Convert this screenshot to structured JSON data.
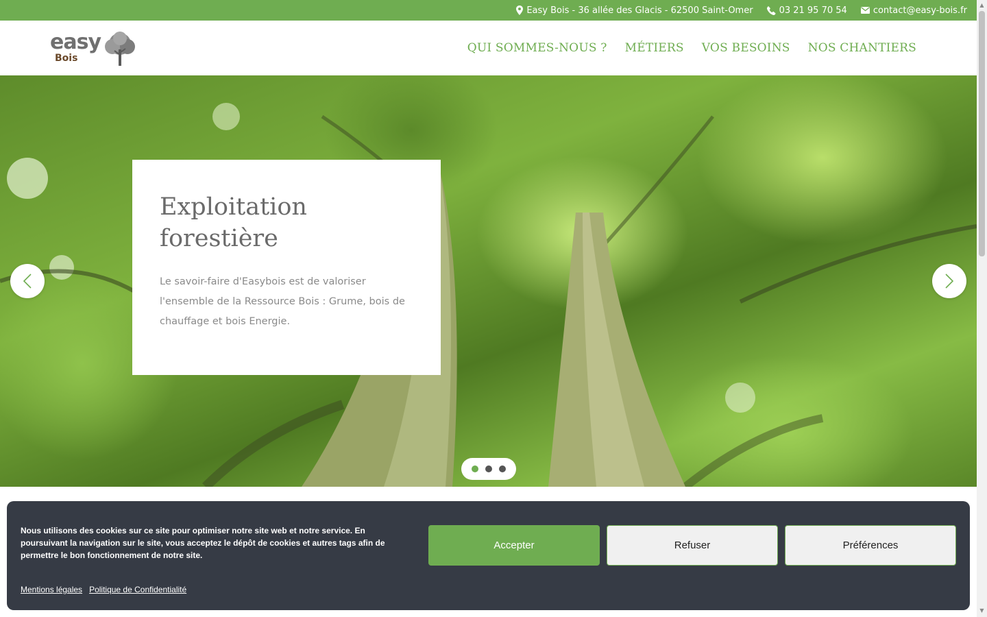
{
  "topbar": {
    "address": "Easy Bois - 36 allée des Glacis - 62500 Saint-Omer",
    "phone": "03 21 95 70 54",
    "email": "contact@easy-bois.fr"
  },
  "logo": {
    "word": "easy",
    "sub": "Bois"
  },
  "nav": [
    {
      "label": "QUI SOMMES-NOUS ?"
    },
    {
      "label": "MÉTIERS"
    },
    {
      "label": "VOS BESOINS"
    },
    {
      "label": "NOS CHANTIERS"
    }
  ],
  "hero": {
    "title_line1": "Exploitation",
    "title_line2": "forestière",
    "text": "Le savoir-faire d'Easybois est de valoriser l'ensemble de la Ressource Bois : Grume, bois de chauffage et bois Energie.",
    "slide_count": 3,
    "active_slide": 1
  },
  "cookie": {
    "message": "Nous utilisons des cookies sur ce site pour optimiser notre site web et notre service. En poursuivant la navigation sur le site, vous acceptez le dépôt de cookies et autres tags afin de permettre le bon fonctionnement de notre site.",
    "link_legal": "Mentions légales",
    "link_privacy": "Politique de Confidentialité",
    "accept": "Accepter",
    "refuse": "Refuser",
    "preferences": "Préférences"
  },
  "colors": {
    "accent": "#6fad51",
    "banner": "#363b45",
    "text_gray": "#6a6a6a"
  },
  "icons": [
    "map-marker-icon",
    "phone-icon",
    "envelope-icon",
    "tree-icon",
    "chevron-left-icon",
    "chevron-right-icon"
  ]
}
